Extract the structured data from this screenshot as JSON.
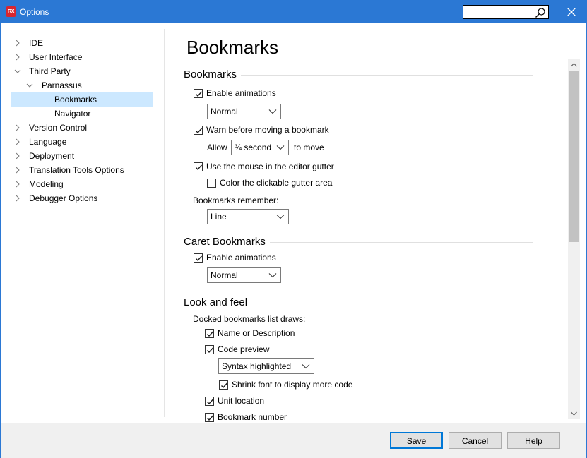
{
  "window": {
    "title": "Options",
    "app_icon_label": "RX",
    "search_placeholder": ""
  },
  "tree": {
    "items": [
      {
        "label": "IDE",
        "level": 0,
        "expanded": false,
        "selected": false
      },
      {
        "label": "User Interface",
        "level": 0,
        "expanded": false,
        "selected": false
      },
      {
        "label": "Third Party",
        "level": 0,
        "expanded": true,
        "selected": false
      },
      {
        "label": "Parnassus",
        "level": 1,
        "expanded": true,
        "selected": false
      },
      {
        "label": "Bookmarks",
        "level": 2,
        "expanded": null,
        "selected": true
      },
      {
        "label": "Navigator",
        "level": 2,
        "expanded": null,
        "selected": false
      },
      {
        "label": "Version Control",
        "level": 0,
        "expanded": false,
        "selected": false
      },
      {
        "label": "Language",
        "level": 0,
        "expanded": false,
        "selected": false
      },
      {
        "label": "Deployment",
        "level": 0,
        "expanded": false,
        "selected": false
      },
      {
        "label": "Translation Tools Options",
        "level": 0,
        "expanded": false,
        "selected": false
      },
      {
        "label": "Modeling",
        "level": 0,
        "expanded": false,
        "selected": false
      },
      {
        "label": "Debugger Options",
        "level": 0,
        "expanded": false,
        "selected": false
      }
    ]
  },
  "page": {
    "title": "Bookmarks",
    "bookmarks": {
      "heading": "Bookmarks",
      "enable_animations": {
        "label": "Enable animations",
        "checked": true
      },
      "animation_speed": "Normal",
      "warn_before_moving": {
        "label": "Warn before moving a bookmark",
        "checked": true
      },
      "allow_label": "Allow",
      "allow_value": "¾ second",
      "to_move_label": "to move",
      "use_mouse_gutter": {
        "label": "Use the mouse in the editor gutter",
        "checked": true
      },
      "color_gutter": {
        "label": "Color the clickable gutter area",
        "checked": false
      },
      "remember_label": "Bookmarks remember:",
      "remember_value": "Line"
    },
    "caret": {
      "heading": "Caret Bookmarks",
      "enable_animations": {
        "label": "Enable animations",
        "checked": true
      },
      "animation_speed": "Normal"
    },
    "look": {
      "heading": "Look and feel",
      "docked_label": "Docked bookmarks list draws:",
      "name_or_desc": {
        "label": "Name or Description",
        "checked": true
      },
      "code_preview": {
        "label": "Code preview",
        "checked": true
      },
      "preview_style": "Syntax highlighted",
      "shrink_font": {
        "label": "Shrink font to display more code",
        "checked": true
      },
      "unit_location": {
        "label": "Unit location",
        "checked": true
      },
      "bookmark_number": {
        "label": "Bookmark number",
        "checked": true
      }
    }
  },
  "footer": {
    "save": "Save",
    "cancel": "Cancel",
    "help": "Help"
  },
  "colors": {
    "titlebar": "#2b78d4",
    "selection": "#cce8ff",
    "checkbox_check": "#1a1a1a",
    "primary_border": "#0078d7"
  }
}
